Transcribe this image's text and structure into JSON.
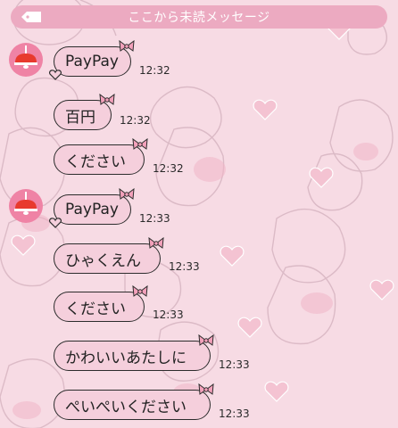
{
  "banner": {
    "label": "ここから未読メッセージ"
  },
  "messages": [
    {
      "text": "PayPay",
      "time": "12:32",
      "avatar": true
    },
    {
      "text": "百円",
      "time": "12:32",
      "avatar": false
    },
    {
      "text": "ください",
      "time": "12:32",
      "avatar": false
    },
    {
      "text": "PayPay",
      "time": "12:33",
      "avatar": true
    },
    {
      "text": "ひゃくえん",
      "time": "12:33",
      "avatar": false
    },
    {
      "text": "ください",
      "time": "12:33",
      "avatar": false
    },
    {
      "text": "かわいいあたしに",
      "time": "12:33",
      "avatar": false
    },
    {
      "text": "ぺいぺいください",
      "time": "12:33",
      "avatar": false
    }
  ],
  "colors": {
    "background": "#f7dbe4",
    "bubble": "#f5cfdc",
    "banner": "#ecaac1",
    "avatar": "#ef83a5"
  }
}
